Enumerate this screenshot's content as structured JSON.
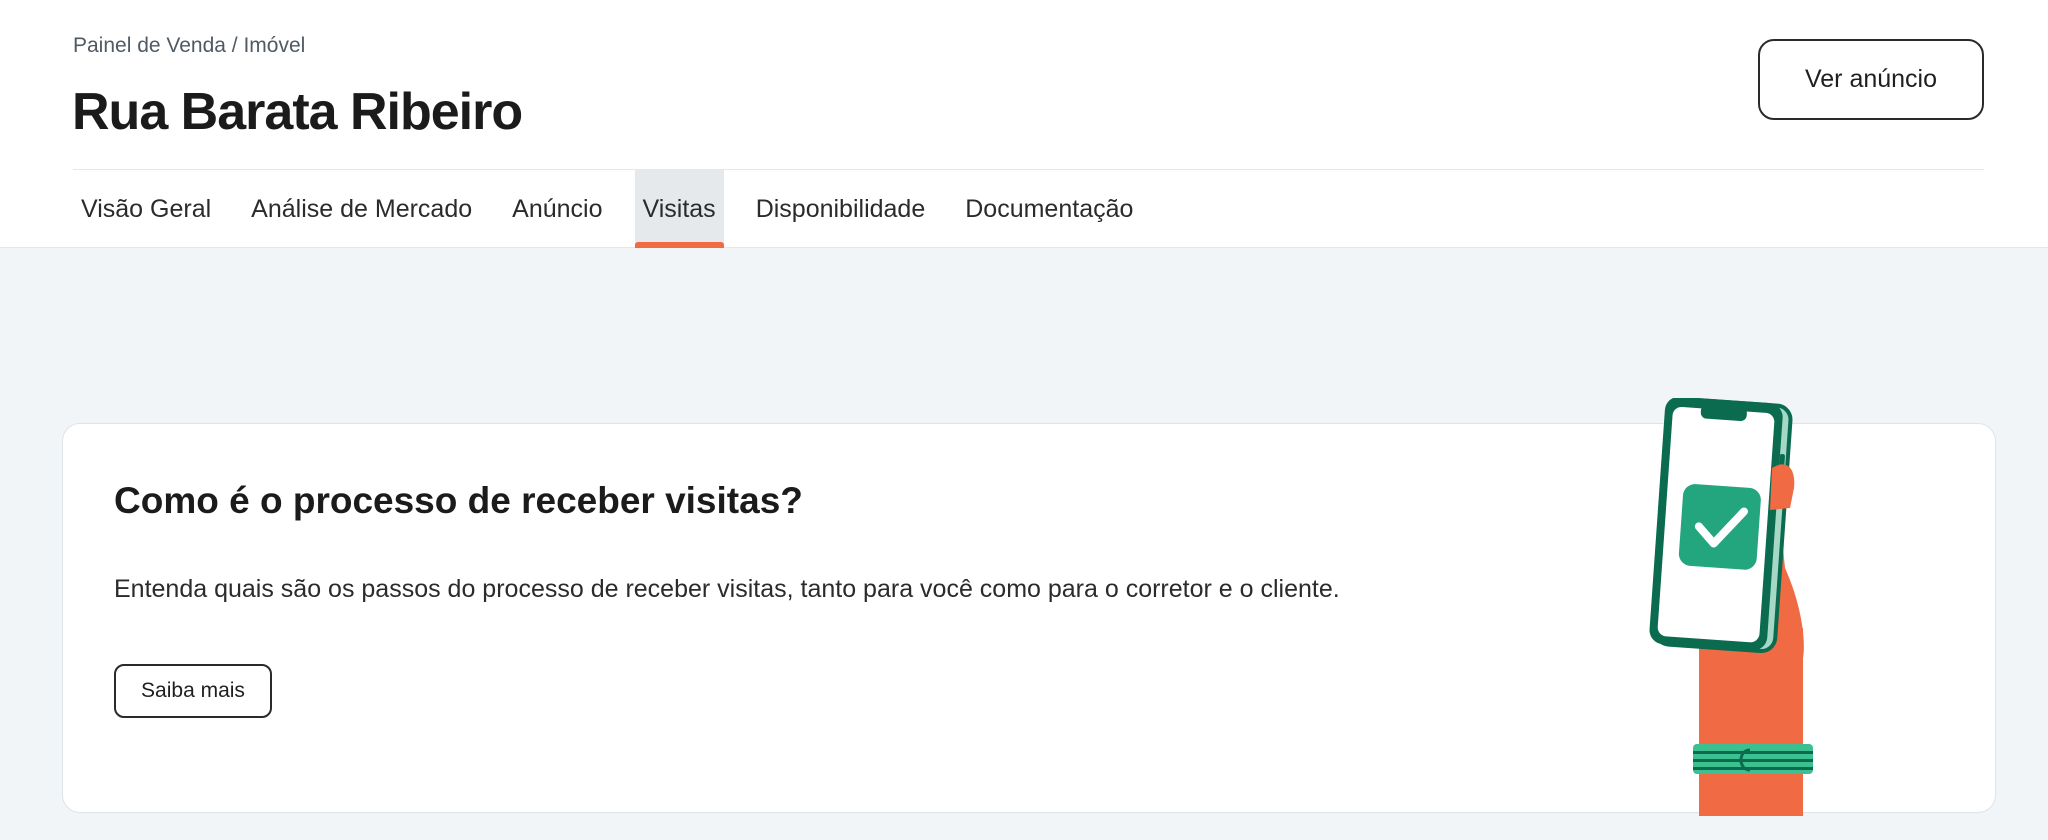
{
  "header": {
    "breadcrumb": "Painel de Venda / Imóvel",
    "title": "Rua Barata Ribeiro",
    "ver_anuncio_label": "Ver anúncio"
  },
  "tabs": [
    {
      "label": "Visão Geral",
      "active": false
    },
    {
      "label": "Análise de Mercado",
      "active": false
    },
    {
      "label": "Anúncio",
      "active": false
    },
    {
      "label": "Visitas",
      "active": true
    },
    {
      "label": "Disponibilidade",
      "active": false
    },
    {
      "label": "Documentação",
      "active": false
    }
  ],
  "card": {
    "title": "Como é o processo de receber visitas?",
    "description": "Entenda quais são os passos do processo de receber visitas, tanto para você como para o corretor e o cliente.",
    "button_label": "Saiba mais",
    "illustration_icon": "phone-check-icon"
  },
  "colors": {
    "accent": "#f06a44",
    "phone_green": "#0b6b4f",
    "check_green": "#23a57e",
    "hand_orange": "#f06a44",
    "bracelet_green": "#3cc08f"
  }
}
